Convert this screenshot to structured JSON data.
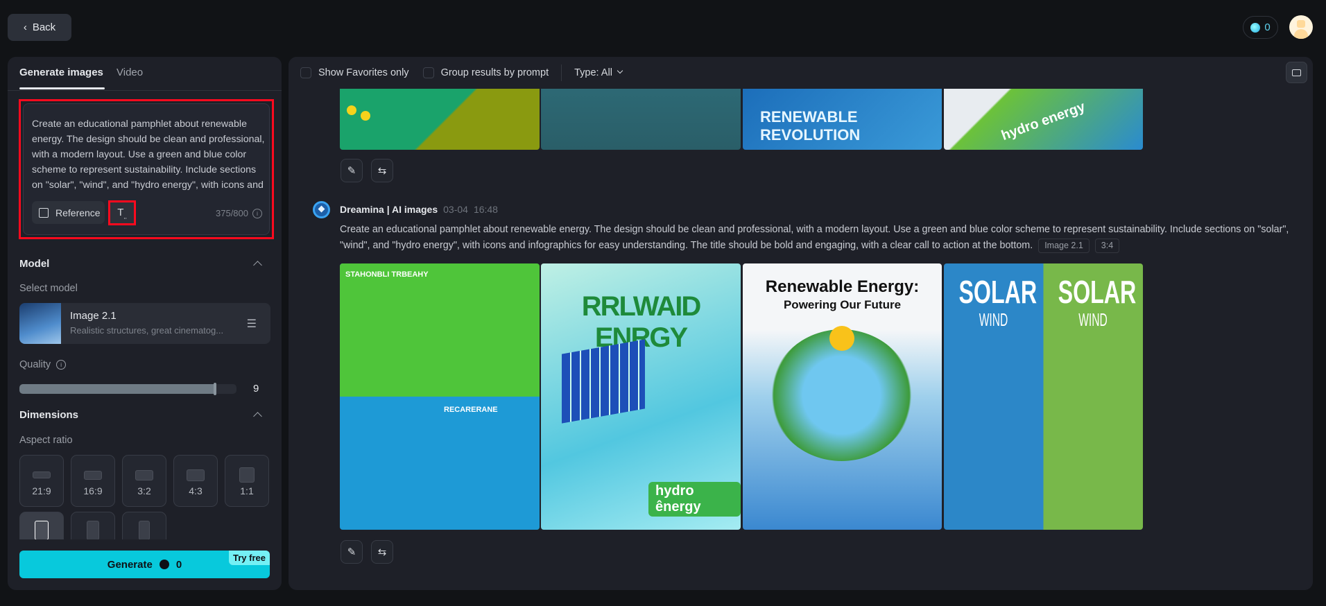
{
  "header": {
    "back_label": "Back",
    "credits": "0"
  },
  "sidebar": {
    "tabs": [
      {
        "label": "Generate images",
        "active": true
      },
      {
        "label": "Video",
        "active": false
      }
    ],
    "prompt": {
      "value": "Create an educational pamphlet about renewable energy. The design should be clean and professional, with a modern layout. Use a green and blue color scheme to represent sustainability. Include sections on \"solar\", \"wind\", and \"hydro energy\", with icons and infographics for easy understanding. The title should be bold and engaging, with a clear call to action at the bottom.",
      "reference_label": "Reference",
      "char_count": "375/800"
    },
    "model": {
      "heading": "Model",
      "select_label": "Select model",
      "name": "Image 2.1",
      "description": "Realistic structures, great cinematog..."
    },
    "quality": {
      "label": "Quality",
      "value": "9",
      "level_fraction": 0.9
    },
    "dimensions": {
      "heading": "Dimensions",
      "aspect_label": "Aspect ratio",
      "ratios": [
        "21:9",
        "16:9",
        "3:2",
        "4:3",
        "1:1"
      ],
      "selected_index": 5
    },
    "generate": {
      "label": "Generate",
      "cost": "0",
      "badge": "Try free"
    },
    "accent_color": "#08c9dc"
  },
  "main": {
    "filters": {
      "favorites_label": "Show Favorites only",
      "group_label": "Group results by prompt",
      "type_label": "Type: All"
    },
    "prev_group": {
      "image_texts": [
        "",
        "",
        "RENEWABLE REVOLUTION",
        "hydro energy"
      ]
    },
    "group": {
      "author": "Dreamina | AI images",
      "date": "03-04",
      "time": "16:48",
      "prompt": "Create an educational pamphlet about renewable energy. The design should be clean and professional, with a modern layout. Use a green and blue color scheme to represent sustainability. Include sections on \"solar\", \"wind\", and \"hydro energy\", with icons and infographics for easy understanding. The title should be bold and engaging, with a clear call to action at the bottom.",
      "model_chip": "Image 2.1",
      "ratio_chip": "3:4",
      "images": [
        {
          "title": "STAHONBLI TRBEAHY",
          "subtitle": "RECARERANE"
        },
        {
          "title": "RRLWAID ENRGY",
          "subtitle": "hydro ênergy"
        },
        {
          "title": "Renewable Energy:",
          "subtitle": "Powering Our Future"
        },
        {
          "title": "SOLAR",
          "subtitle": "WIND"
        }
      ]
    }
  }
}
